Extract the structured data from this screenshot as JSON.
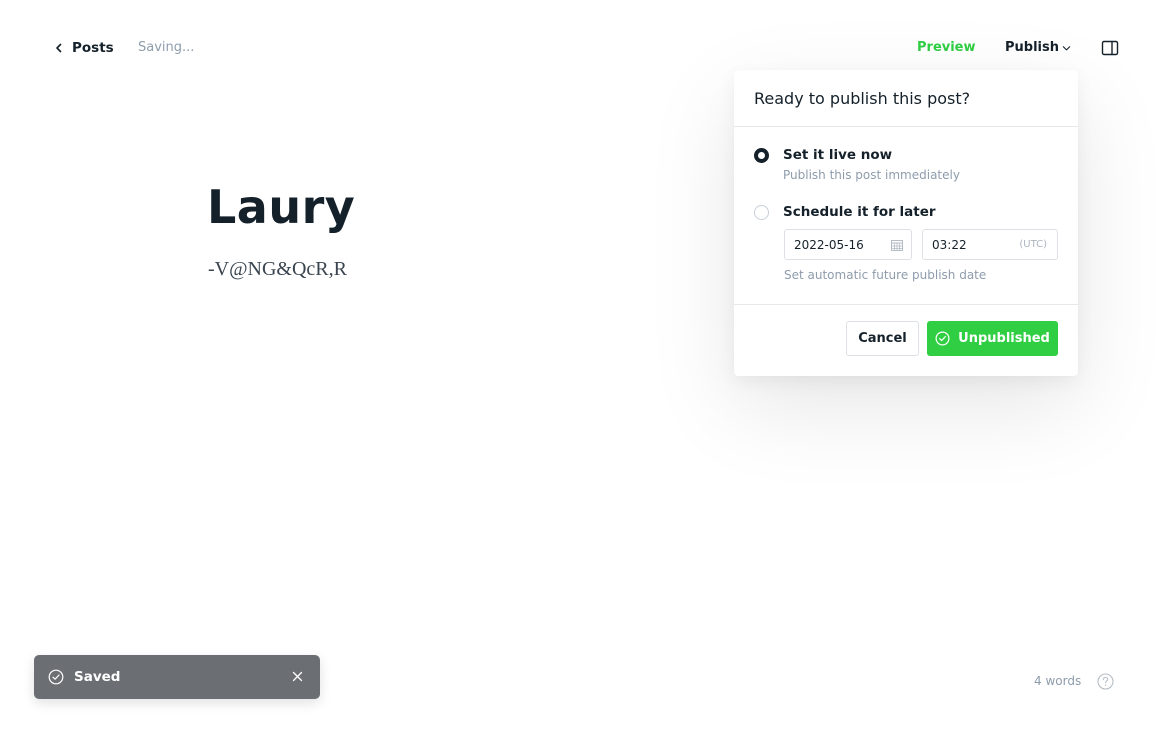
{
  "header": {
    "back_label": "Posts",
    "status": "Saving...",
    "preview_label": "Preview",
    "publish_label": "Publish"
  },
  "post": {
    "title": "Laury",
    "body": "-V@NG&QcR,R"
  },
  "publish_menu": {
    "title": "Ready to publish this post?",
    "options": [
      {
        "label": "Set it live now",
        "description": "Publish this post immediately",
        "selected": true
      },
      {
        "label": "Schedule it for later",
        "selected": false
      }
    ],
    "schedule": {
      "date": "2022-05-16",
      "time": "03:22",
      "timezone": "(UTC)",
      "hint": "Set automatic future publish date"
    },
    "cancel_label": "Cancel",
    "confirm_label": "Unpublished"
  },
  "toast": {
    "message": "Saved"
  },
  "footer": {
    "word_count": "4 words"
  },
  "colors": {
    "accent_green": "#30cf43",
    "text_dark": "#15212a",
    "text_muted": "#8e9cac",
    "toast_bg": "#6b6f73"
  }
}
